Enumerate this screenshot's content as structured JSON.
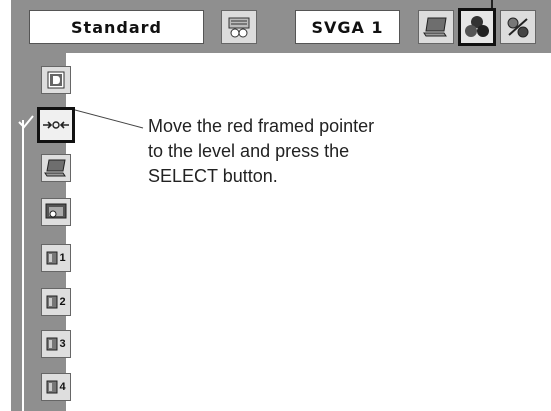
{
  "header": {
    "mode_label": "Standard",
    "resolution_label": "SVGA 1"
  },
  "icons": {
    "top": [
      "pc-adjust-icon",
      "screen-icon",
      "image-adjust-icon",
      "image-select-icon"
    ],
    "side": [
      "digital-mode-icon",
      "level-pointer-icon",
      "screen-icon",
      "keystone-icon",
      "memory-1-icon",
      "memory-2-icon",
      "memory-3-icon",
      "memory-4-icon"
    ]
  },
  "instruction": {
    "lines": [
      "Move the red framed pointer",
      "to the level and press the",
      "SELECT button."
    ]
  },
  "memory_labels": [
    "1",
    "2",
    "3",
    "4"
  ],
  "colors": {
    "menu_bg": "#8f8f8f",
    "selection_frame": "#111111"
  }
}
